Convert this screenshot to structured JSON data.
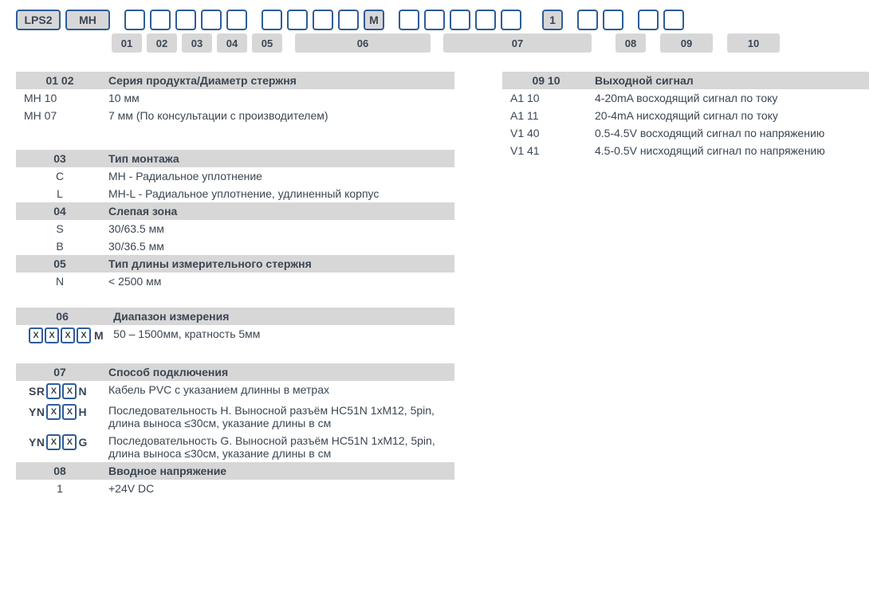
{
  "top_boxes": {
    "b1": "LPS2",
    "b2": "MH",
    "b12": "M",
    "b19": "1"
  },
  "labels": {
    "l01": "01",
    "l02": "02",
    "l03": "03",
    "l04": "04",
    "l05": "05",
    "l06": "06",
    "l07": "07",
    "l08": "08",
    "l09": "09",
    "l10": "10"
  },
  "sec0102": {
    "hKey": "01 02",
    "hTitle": "Серия продукта/Диаметр стержня",
    "r1k": "MH 10",
    "r1v": "10 мм",
    "r2k": "MH 07",
    "r2v": "7 мм (По консультации с производителем)"
  },
  "sec03": {
    "hKey": "03",
    "hTitle": "Тип монтажа",
    "r1k": "C",
    "r1v": "MH - Радиальное уплотнение",
    "r2k": "L",
    "r2v": "MH-L - Радиальное уплотнение, удлиненный корпус"
  },
  "sec04": {
    "hKey": "04",
    "hTitle": "Слепая зона",
    "r1k": "S",
    "r1v": "30/63.5 мм",
    "r2k": "B",
    "r2v": "30/36.5 мм"
  },
  "sec05": {
    "hKey": "05",
    "hTitle": "Тип длины измерительного стержня",
    "r1k": "N",
    "r1v": "< 2500 мм"
  },
  "sec06": {
    "hKey": "06",
    "hTitle": "Диапазон измерения",
    "r1_after": "M",
    "r1v": "50 – 1500мм, кратность 5мм",
    "x": "X"
  },
  "sec07": {
    "hKey": "07",
    "hTitle": "Способ подключения",
    "r1_pre": "SR",
    "r1_post": "N",
    "r1v": "Кабель PVC с указанием длинны в метрах",
    "r2_pre": "YN",
    "r2_post": "H",
    "r2v": "Последовательность H. Выносной разъём HC51N 1xM12, 5pin, длина выноса ≤30см, указание длины в см",
    "r3_pre": "YN",
    "r3_post": "G",
    "r3v": "Последовательность G. Выносной разъём HC51N 1xM12, 5pin, длина выноса ≤30см, указание длины в см",
    "x": "X"
  },
  "sec08": {
    "hKey": "08",
    "hTitle": "Вводное напряжение",
    "r1k": "1",
    "r1v": "+24V DC"
  },
  "sec0910": {
    "hKey": "09 10",
    "hTitle": "Выходной сигнал",
    "r1k": "A1 10",
    "r1v": "4-20mA  восходящий сигнал по току",
    "r2k": "A1 11",
    "r2v": "20-4mA нисходящий сигнал по току",
    "r3k": "V1 40",
    "r3v": "0.5-4.5V восходящий сигнал по напряжению",
    "r4k": "V1 41",
    "r4v": "4.5-0.5V нисходящий сигнал по напряжению"
  }
}
